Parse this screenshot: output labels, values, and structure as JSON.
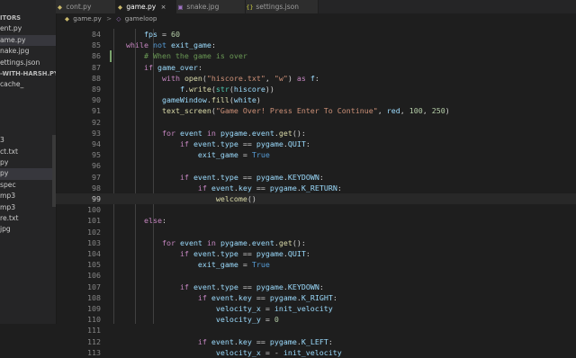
{
  "sidebar": {
    "items": [
      {
        "label": "ITORS",
        "bold": true
      },
      {
        "label": "ent.py"
      },
      {
        "label": "ame.py",
        "active": true
      },
      {
        "label": "nake.jpg"
      },
      {
        "label": "ettings.json"
      },
      {
        "label": "-WITH-HARSH.PY...",
        "bold": true
      },
      {
        "label": "cache_"
      },
      {
        "label": ""
      },
      {
        "label": ""
      },
      {
        "label": ""
      },
      {
        "label": ""
      },
      {
        "label": "3"
      },
      {
        "label": "ct.txt"
      },
      {
        "label": "py"
      },
      {
        "label": "py",
        "active": true
      },
      {
        "label": "spec"
      },
      {
        "label": "mp3"
      },
      {
        "label": "mp3"
      },
      {
        "label": "re.txt"
      },
      {
        "label": "jpg"
      }
    ]
  },
  "tabs": [
    {
      "label": "cont.py",
      "icon": "python-file-icon",
      "active": false
    },
    {
      "label": "game.py",
      "icon": "python-file-icon",
      "active": true
    },
    {
      "label": "snake.jpg",
      "icon": "image-file-icon",
      "active": false
    },
    {
      "label": "settings.json",
      "icon": "json-file-icon",
      "active": false
    }
  ],
  "tab_close_glyph": "×",
  "breadcrumb": {
    "file": "game.py",
    "separator": ">",
    "symbol": "gameloop"
  },
  "editor": {
    "lines": [
      {
        "n": "84",
        "tokens": [
          [
            "        ",
            ""
          ],
          [
            "fps",
            "var"
          ],
          [
            " = ",
            ""
          ],
          [
            "60",
            "num"
          ]
        ]
      },
      {
        "n": "85",
        "tokens": [
          [
            "    ",
            ""
          ],
          [
            "while",
            "kw"
          ],
          [
            " ",
            ""
          ],
          [
            "not",
            "kwb"
          ],
          [
            " ",
            ""
          ],
          [
            "exit_game",
            "var"
          ],
          [
            ":",
            ""
          ]
        ]
      },
      {
        "n": "86",
        "tokens": [
          [
            "        ",
            ""
          ],
          [
            "# When the game is over",
            "cmt"
          ]
        ],
        "mark": true
      },
      {
        "n": "87",
        "tokens": [
          [
            "        ",
            ""
          ],
          [
            "if",
            "kw"
          ],
          [
            " ",
            ""
          ],
          [
            "game_over",
            "var"
          ],
          [
            ":",
            ""
          ]
        ]
      },
      {
        "n": "88",
        "tokens": [
          [
            "            ",
            ""
          ],
          [
            "with",
            "kw"
          ],
          [
            " ",
            ""
          ],
          [
            "open",
            "fn"
          ],
          [
            "(",
            ""
          ],
          [
            "\"hiscore.txt\"",
            "str"
          ],
          [
            ", ",
            ""
          ],
          [
            "\"w\"",
            "str"
          ],
          [
            ") ",
            ""
          ],
          [
            "as",
            "kw"
          ],
          [
            " ",
            ""
          ],
          [
            "f",
            "var"
          ],
          [
            ":",
            ""
          ]
        ]
      },
      {
        "n": "89",
        "tokens": [
          [
            "                ",
            ""
          ],
          [
            "f",
            "var"
          ],
          [
            ".",
            ""
          ],
          [
            "write",
            "fn"
          ],
          [
            "(",
            ""
          ],
          [
            "str",
            "cls"
          ],
          [
            "(",
            ""
          ],
          [
            "hiscore",
            "var"
          ],
          [
            "))",
            ""
          ]
        ]
      },
      {
        "n": "90",
        "tokens": [
          [
            "            ",
            ""
          ],
          [
            "gameWindow",
            "var"
          ],
          [
            ".",
            ""
          ],
          [
            "fill",
            "fn"
          ],
          [
            "(",
            ""
          ],
          [
            "white",
            "var"
          ],
          [
            ")",
            ""
          ]
        ]
      },
      {
        "n": "91",
        "tokens": [
          [
            "            ",
            ""
          ],
          [
            "text_screen",
            "fn"
          ],
          [
            "(",
            ""
          ],
          [
            "\"Game Over! Press Enter To Continue\"",
            "str"
          ],
          [
            ", ",
            ""
          ],
          [
            "red",
            "var"
          ],
          [
            ", ",
            ""
          ],
          [
            "100",
            "num"
          ],
          [
            ", ",
            ""
          ],
          [
            "250",
            "num"
          ],
          [
            ")",
            ""
          ]
        ]
      },
      {
        "n": "92",
        "tokens": []
      },
      {
        "n": "93",
        "tokens": [
          [
            "            ",
            ""
          ],
          [
            "for",
            "kw"
          ],
          [
            " ",
            ""
          ],
          [
            "event",
            "var"
          ],
          [
            " ",
            ""
          ],
          [
            "in",
            "kw"
          ],
          [
            " ",
            ""
          ],
          [
            "pygame",
            "var"
          ],
          [
            ".",
            ""
          ],
          [
            "event",
            "var"
          ],
          [
            ".",
            ""
          ],
          [
            "get",
            "fn"
          ],
          [
            "():",
            ""
          ]
        ]
      },
      {
        "n": "94",
        "tokens": [
          [
            "                ",
            ""
          ],
          [
            "if",
            "kw"
          ],
          [
            " ",
            ""
          ],
          [
            "event",
            "var"
          ],
          [
            ".",
            ""
          ],
          [
            "type",
            "var"
          ],
          [
            " == ",
            ""
          ],
          [
            "pygame",
            "var"
          ],
          [
            ".",
            ""
          ],
          [
            "QUIT",
            "var"
          ],
          [
            ":",
            ""
          ]
        ]
      },
      {
        "n": "95",
        "tokens": [
          [
            "                    ",
            ""
          ],
          [
            "exit_game",
            "var"
          ],
          [
            " = ",
            ""
          ],
          [
            "True",
            "kwb"
          ]
        ]
      },
      {
        "n": "96",
        "tokens": []
      },
      {
        "n": "97",
        "tokens": [
          [
            "                ",
            ""
          ],
          [
            "if",
            "kw"
          ],
          [
            " ",
            ""
          ],
          [
            "event",
            "var"
          ],
          [
            ".",
            ""
          ],
          [
            "type",
            "var"
          ],
          [
            " == ",
            ""
          ],
          [
            "pygame",
            "var"
          ],
          [
            ".",
            ""
          ],
          [
            "KEYDOWN",
            "var"
          ],
          [
            ":",
            ""
          ]
        ]
      },
      {
        "n": "98",
        "tokens": [
          [
            "                    ",
            ""
          ],
          [
            "if",
            "kw"
          ],
          [
            " ",
            ""
          ],
          [
            "event",
            "var"
          ],
          [
            ".",
            ""
          ],
          [
            "key",
            "var"
          ],
          [
            " == ",
            ""
          ],
          [
            "pygame",
            "var"
          ],
          [
            ".",
            ""
          ],
          [
            "K_RETURN",
            "var"
          ],
          [
            ":",
            ""
          ]
        ]
      },
      {
        "n": "99",
        "tokens": [
          [
            "                        ",
            ""
          ],
          [
            "welcome",
            "fn"
          ],
          [
            "()",
            ""
          ]
        ],
        "current": true
      },
      {
        "n": "100",
        "tokens": []
      },
      {
        "n": "101",
        "tokens": [
          [
            "        ",
            ""
          ],
          [
            "else",
            "kw"
          ],
          [
            ":",
            ""
          ]
        ]
      },
      {
        "n": "102",
        "tokens": []
      },
      {
        "n": "103",
        "tokens": [
          [
            "            ",
            ""
          ],
          [
            "for",
            "kw"
          ],
          [
            " ",
            ""
          ],
          [
            "event",
            "var"
          ],
          [
            " ",
            ""
          ],
          [
            "in",
            "kw"
          ],
          [
            " ",
            ""
          ],
          [
            "pygame",
            "var"
          ],
          [
            ".",
            ""
          ],
          [
            "event",
            "var"
          ],
          [
            ".",
            ""
          ],
          [
            "get",
            "fn"
          ],
          [
            "():",
            ""
          ]
        ]
      },
      {
        "n": "104",
        "tokens": [
          [
            "                ",
            ""
          ],
          [
            "if",
            "kw"
          ],
          [
            " ",
            ""
          ],
          [
            "event",
            "var"
          ],
          [
            ".",
            ""
          ],
          [
            "type",
            "var"
          ],
          [
            " == ",
            ""
          ],
          [
            "pygame",
            "var"
          ],
          [
            ".",
            ""
          ],
          [
            "QUIT",
            "var"
          ],
          [
            ":",
            ""
          ]
        ]
      },
      {
        "n": "105",
        "tokens": [
          [
            "                    ",
            ""
          ],
          [
            "exit_game",
            "var"
          ],
          [
            " = ",
            ""
          ],
          [
            "True",
            "kwb"
          ]
        ]
      },
      {
        "n": "106",
        "tokens": []
      },
      {
        "n": "107",
        "tokens": [
          [
            "                ",
            ""
          ],
          [
            "if",
            "kw"
          ],
          [
            " ",
            ""
          ],
          [
            "event",
            "var"
          ],
          [
            ".",
            ""
          ],
          [
            "type",
            "var"
          ],
          [
            " == ",
            ""
          ],
          [
            "pygame",
            "var"
          ],
          [
            ".",
            ""
          ],
          [
            "KEYDOWN",
            "var"
          ],
          [
            ":",
            ""
          ]
        ]
      },
      {
        "n": "108",
        "tokens": [
          [
            "                    ",
            ""
          ],
          [
            "if",
            "kw"
          ],
          [
            " ",
            ""
          ],
          [
            "event",
            "var"
          ],
          [
            ".",
            ""
          ],
          [
            "key",
            "var"
          ],
          [
            " == ",
            ""
          ],
          [
            "pygame",
            "var"
          ],
          [
            ".",
            ""
          ],
          [
            "K_RIGHT",
            "var"
          ],
          [
            ":",
            ""
          ]
        ]
      },
      {
        "n": "109",
        "tokens": [
          [
            "                        ",
            ""
          ],
          [
            "velocity_x",
            "var"
          ],
          [
            " = ",
            ""
          ],
          [
            "init_velocity",
            "var"
          ]
        ]
      },
      {
        "n": "110",
        "tokens": [
          [
            "                        ",
            ""
          ],
          [
            "velocity_y",
            "var"
          ],
          [
            " = ",
            ""
          ],
          [
            "0",
            "num"
          ]
        ]
      },
      {
        "n": "111",
        "tokens": []
      },
      {
        "n": "112",
        "tokens": [
          [
            "                    ",
            ""
          ],
          [
            "if",
            "kw"
          ],
          [
            " ",
            ""
          ],
          [
            "event",
            "var"
          ],
          [
            ".",
            ""
          ],
          [
            "key",
            "var"
          ],
          [
            " == ",
            ""
          ],
          [
            "pygame",
            "var"
          ],
          [
            ".",
            ""
          ],
          [
            "K_LEFT",
            "var"
          ],
          [
            ":",
            ""
          ]
        ]
      },
      {
        "n": "113",
        "tokens": [
          [
            "                        ",
            ""
          ],
          [
            "velocity_x",
            "var"
          ],
          [
            " = - ",
            ""
          ],
          [
            "init_velocity",
            "var"
          ]
        ]
      }
    ]
  },
  "colors": {
    "background": "#1e1e1e",
    "sidebar": "#252526",
    "keyword": "#c586c0",
    "string": "#ce9178",
    "comment": "#6a9955",
    "function": "#dcdcaa",
    "variable": "#9cdcfe",
    "number": "#b5cea8"
  }
}
